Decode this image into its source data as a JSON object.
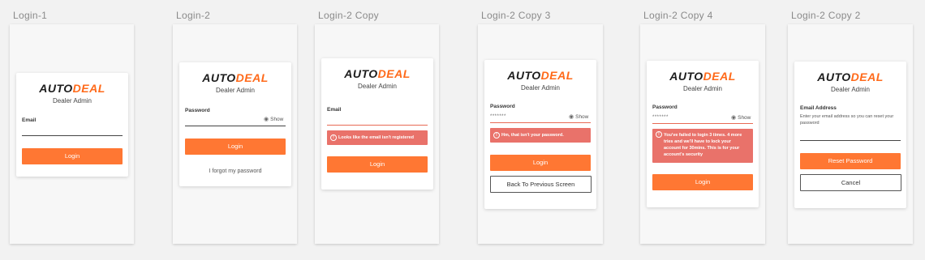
{
  "brand": {
    "auto": "AUTO",
    "deal": "DEAL",
    "subtitle": "Dealer Admin"
  },
  "artboards": [
    {
      "title": "Login-1",
      "email_label": "Email",
      "login_button": "Login"
    },
    {
      "title": "Login-2",
      "password_label": "Password",
      "show_label": "Show",
      "login_button": "Login",
      "forgot_link": "I forgot my password"
    },
    {
      "title": "Login-2 Copy",
      "email_label": "Email",
      "alert": "Looks like the email isn't registered",
      "login_button": "Login"
    },
    {
      "title": "Login-2 Copy 3",
      "password_label": "Password",
      "password_value": "*******",
      "show_label": "Show",
      "alert": "Hm, that isn't your password.",
      "login_button": "Login",
      "back_button": "Back To Previous Screen"
    },
    {
      "title": "Login-2 Copy 4",
      "password_label": "Password",
      "password_value": "*******",
      "show_label": "Show",
      "alert": "You've failed to login 3 times. 4 more tries and we'll have to lock your account for 30mins. This is for your account's security",
      "login_button": "Login"
    },
    {
      "title": "Login-2 Copy 2",
      "email_label": "Email Address",
      "hint": "Enter your email address so you can reset your password",
      "reset_button": "Reset Password",
      "cancel_button": "Cancel"
    }
  ],
  "colors": {
    "accent": "#ff7733",
    "error": "#e9726a",
    "background": "#f2f2f2"
  },
  "icons": {
    "show": "eye-icon",
    "alert": "alert-circle-icon"
  }
}
